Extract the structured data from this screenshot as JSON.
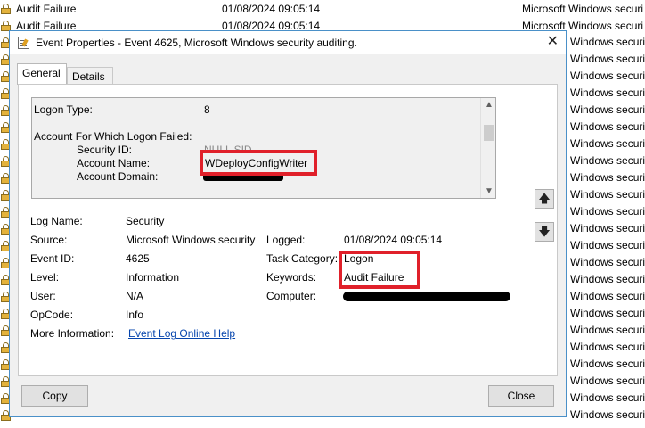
{
  "background_list": {
    "keyword": "Audit Failure",
    "datetime": "01/08/2024 09:05:14",
    "source": "Microsoft Windows securi",
    "side_text": "Windows securi"
  },
  "dialog": {
    "title": "Event Properties - Event 4625, Microsoft Windows security auditing.",
    "tabs": [
      "General",
      "Details"
    ],
    "description": {
      "logon_type_label": "Logon Type:",
      "logon_type_value": "8",
      "account_header": "Account For Which Logon Failed:",
      "security_id_label": "Security ID:",
      "security_id_value": "NULL SID",
      "account_name_label": "Account Name:",
      "account_name_value": "WDeployConfigWriter",
      "account_domain_label": "Account Domain:"
    },
    "fields": {
      "log_name_label": "Log Name:",
      "log_name_value": "Security",
      "source_label": "Source:",
      "source_value": "Microsoft Windows security",
      "logged_label": "Logged:",
      "logged_value": "01/08/2024 09:05:14",
      "event_id_label": "Event ID:",
      "event_id_value": "4625",
      "task_category_label": "Task Category:",
      "task_category_value": "Logon",
      "level_label": "Level:",
      "level_value": "Information",
      "keywords_label": "Keywords:",
      "keywords_value": "Audit Failure",
      "user_label": "User:",
      "user_value": "N/A",
      "computer_label": "Computer:",
      "opcode_label": "OpCode:",
      "opcode_value": "Info",
      "more_info_label": "More Information:",
      "more_info_link": "Event Log Online Help"
    },
    "buttons": {
      "copy": "Copy",
      "close": "Close"
    },
    "icons": {
      "title": "event-properties-icon",
      "close": "close-icon",
      "up": "arrow-up-icon",
      "down": "arrow-down-icon"
    }
  },
  "colors": {
    "highlight": "#e0202a",
    "dialog_border": "#4a90c8",
    "link": "#0645ad"
  }
}
